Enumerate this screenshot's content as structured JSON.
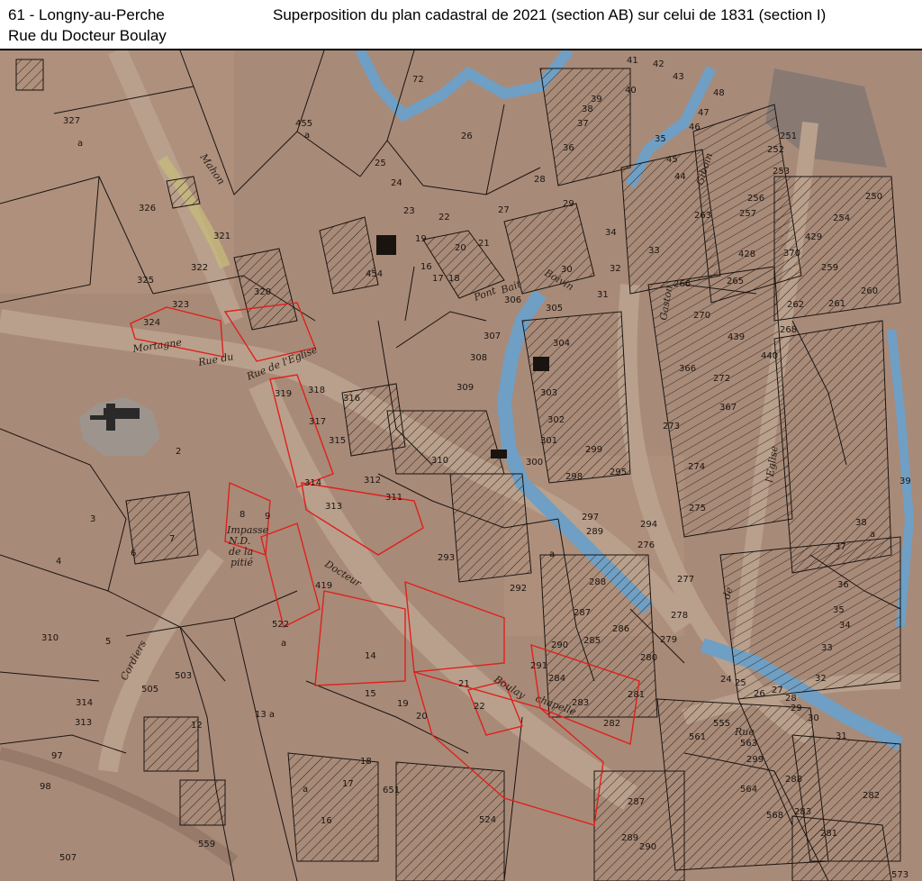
{
  "header": {
    "location_line1": "61 - Longny-au-Perche",
    "location_line2": "Rue du Docteur Boulay",
    "title": "Superposition du plan cadastral de 2021 (section AB) sur celui de 1831 (section I)"
  },
  "map": {
    "colors": {
      "parchment": "#a88a78",
      "parchment_light": "#b89a86",
      "road": "#b9a08c",
      "water": "#6f9fc4",
      "highlight": "#e0201c",
      "hatch": "#2a2018",
      "parcel_line": "#1a1410",
      "church": "#3a3a3a"
    },
    "street_labels": [
      "Mahon",
      "Rue de l'Eglise",
      "Rue du",
      "Docteur",
      "Boulay",
      "Pont",
      "Bait",
      "Boivin",
      "Gaston",
      "Giboin",
      "Impasse",
      "N.D.",
      "de la",
      "pitié",
      "Cordiers",
      "Rue",
      "de",
      "l'Eglise",
      "chapelle",
      "Mortagne"
    ],
    "parcel_numbers": [
      "72",
      "26",
      "25",
      "24",
      "23",
      "22",
      "21",
      "20",
      "19",
      "18",
      "17",
      "16",
      "27",
      "28",
      "29",
      "30",
      "31",
      "41",
      "42",
      "43",
      "40",
      "39",
      "38",
      "37",
      "36",
      "35",
      "34",
      "33",
      "32",
      "48",
      "47",
      "46",
      "45",
      "44",
      "252",
      "251",
      "253",
      "250",
      "256",
      "257",
      "254",
      "263",
      "428",
      "429",
      "370",
      "259",
      "260",
      "261",
      "262",
      "265",
      "266",
      "268",
      "270",
      "439",
      "440",
      "272",
      "366",
      "367",
      "273",
      "274",
      "275",
      "327",
      "326",
      "325",
      "324",
      "323",
      "322",
      "321",
      "320",
      "455",
      "454",
      "305",
      "306",
      "307",
      "308",
      "309",
      "310",
      "311",
      "312",
      "313",
      "314",
      "315",
      "316",
      "317",
      "318",
      "319",
      "304",
      "303",
      "302",
      "301",
      "300",
      "299",
      "298",
      "297",
      "295",
      "294",
      "293",
      "292",
      "291",
      "290",
      "289",
      "288",
      "287",
      "286",
      "285",
      "284",
      "283",
      "282",
      "281",
      "280",
      "279",
      "278",
      "276",
      "277",
      "278",
      "2",
      "3",
      "4",
      "5",
      "6",
      "7",
      "8",
      "9",
      "12",
      "13 a",
      "14",
      "15",
      "16",
      "17",
      "18",
      "19",
      "20",
      "21",
      "22",
      "310",
      "314",
      "313",
      "97",
      "98",
      "503",
      "505",
      "507",
      "522",
      "559",
      "524",
      "651",
      "419",
      "555",
      "561",
      "563",
      "564",
      "568",
      "283",
      "281",
      "282",
      "289",
      "290",
      "287",
      "288",
      "299",
      "24",
      "25",
      "26",
      "27",
      "28",
      "29",
      "30",
      "31",
      "32",
      "33",
      "34",
      "35",
      "36",
      "37",
      "38",
      "39",
      "573",
      "a"
    ]
  }
}
